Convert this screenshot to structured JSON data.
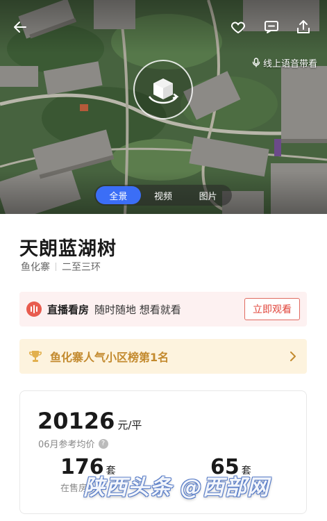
{
  "hero": {
    "voice_label": "线上语音带看",
    "tabs": [
      {
        "label": "全景",
        "active": true
      },
      {
        "label": "视频",
        "active": false
      },
      {
        "label": "图片",
        "active": false
      }
    ]
  },
  "estate": {
    "name": "天朗蓝湖树",
    "district": "鱼化寨",
    "ring": "二至三环"
  },
  "live": {
    "title": "直播看房",
    "subtitle": "随时随地 想看就看",
    "button": "立即观看"
  },
  "rank": {
    "text": "鱼化寨人气小区榜第1名"
  },
  "price": {
    "value": "20126",
    "unit": "元/平",
    "label": "06月参考均价",
    "help": "?"
  },
  "stats": {
    "on_sale_value": "176",
    "on_sale_unit": "套",
    "on_sale_label": "在售房",
    "second_value": "65",
    "second_unit": "套"
  },
  "watermark": "陕西头条 @西部网",
  "colors": {
    "accent": "#3b6ef6",
    "live_red": "#e0443a",
    "rank_gold": "#c38a2e"
  }
}
